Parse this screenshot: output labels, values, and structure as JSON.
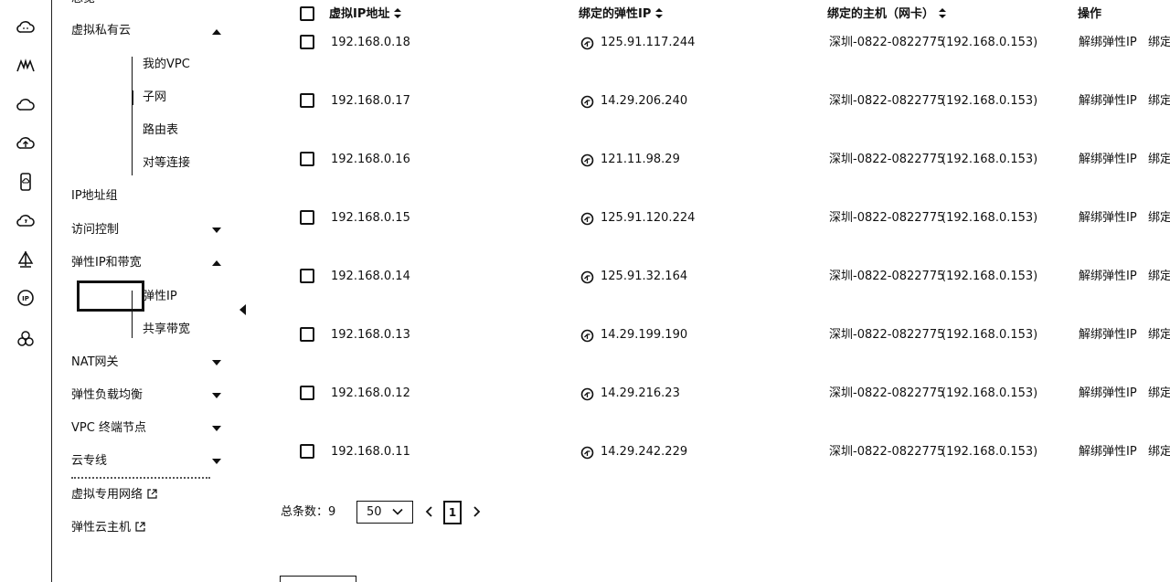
{
  "rail_icons": [
    "cloud-smile-icon",
    "mountain-icon",
    "cloud-icon",
    "cloud-upload-icon",
    "phone-cloud-icon",
    "cloud-power-icon",
    "sail-icon",
    "ip-icon",
    "cluster-icon"
  ],
  "nav": {
    "overview": "总览",
    "vpc_group": "虚拟私有云",
    "my_vpc": "我的VPC",
    "subnet": "子网",
    "route_table": "路由表",
    "peering": "对等连接",
    "ip_group": "IP地址组",
    "access_control": "访问控制",
    "eip_bandwidth": "弹性IP和带宽",
    "eip": "弹性IP",
    "shared_bandwidth": "共享带宽",
    "nat": "NAT网关",
    "elb": "弹性负载均衡",
    "vpc_endpoint": "VPC 终端节点",
    "direct_connect": "云专线",
    "vpn": "虚拟专用网络",
    "ecs": "弹性云主机"
  },
  "table": {
    "headers": {
      "private_ip": "虚拟IP地址",
      "eip": "绑定的弹性IP",
      "host": "绑定的主机（网卡）",
      "ops": "操作"
    },
    "rows": [
      {
        "private_ip": "192.168.0.18",
        "eip": "125.91.117.244",
        "host": "深圳-0822-0822775",
        "nic": "(192.168.0.153)",
        "action1": "解绑弹性IP",
        "action2": "绑定"
      },
      {
        "private_ip": "192.168.0.17",
        "eip": "14.29.206.240",
        "host": "深圳-0822-0822775",
        "nic": "(192.168.0.153)",
        "action1": "解绑弹性IP",
        "action2": "绑定"
      },
      {
        "private_ip": "192.168.0.16",
        "eip": "121.11.98.29",
        "host": "深圳-0822-0822775",
        "nic": "(192.168.0.153)",
        "action1": "解绑弹性IP",
        "action2": "绑定"
      },
      {
        "private_ip": "192.168.0.15",
        "eip": "125.91.120.224",
        "host": "深圳-0822-0822775",
        "nic": "(192.168.0.153)",
        "action1": "解绑弹性IP",
        "action2": "绑定"
      },
      {
        "private_ip": "192.168.0.14",
        "eip": "125.91.32.164",
        "host": "深圳-0822-0822775",
        "nic": "(192.168.0.153)",
        "action1": "解绑弹性IP",
        "action2": "绑定"
      },
      {
        "private_ip": "192.168.0.13",
        "eip": "14.29.199.190",
        "host": "深圳-0822-0822775",
        "nic": "(192.168.0.153)",
        "action1": "解绑弹性IP",
        "action2": "绑定"
      },
      {
        "private_ip": "192.168.0.12",
        "eip": "14.29.216.23",
        "host": "深圳-0822-0822775",
        "nic": "(192.168.0.153)",
        "action1": "解绑弹性IP",
        "action2": "绑定"
      },
      {
        "private_ip": "192.168.0.11",
        "eip": "14.29.242.229",
        "host": "深圳-0822-0822775",
        "nic": "(192.168.0.153)",
        "action1": "解绑弹性IP",
        "action2": "绑定"
      }
    ]
  },
  "pagination": {
    "total_label": "总条数：9",
    "page_size": "50",
    "current_page": "1"
  }
}
